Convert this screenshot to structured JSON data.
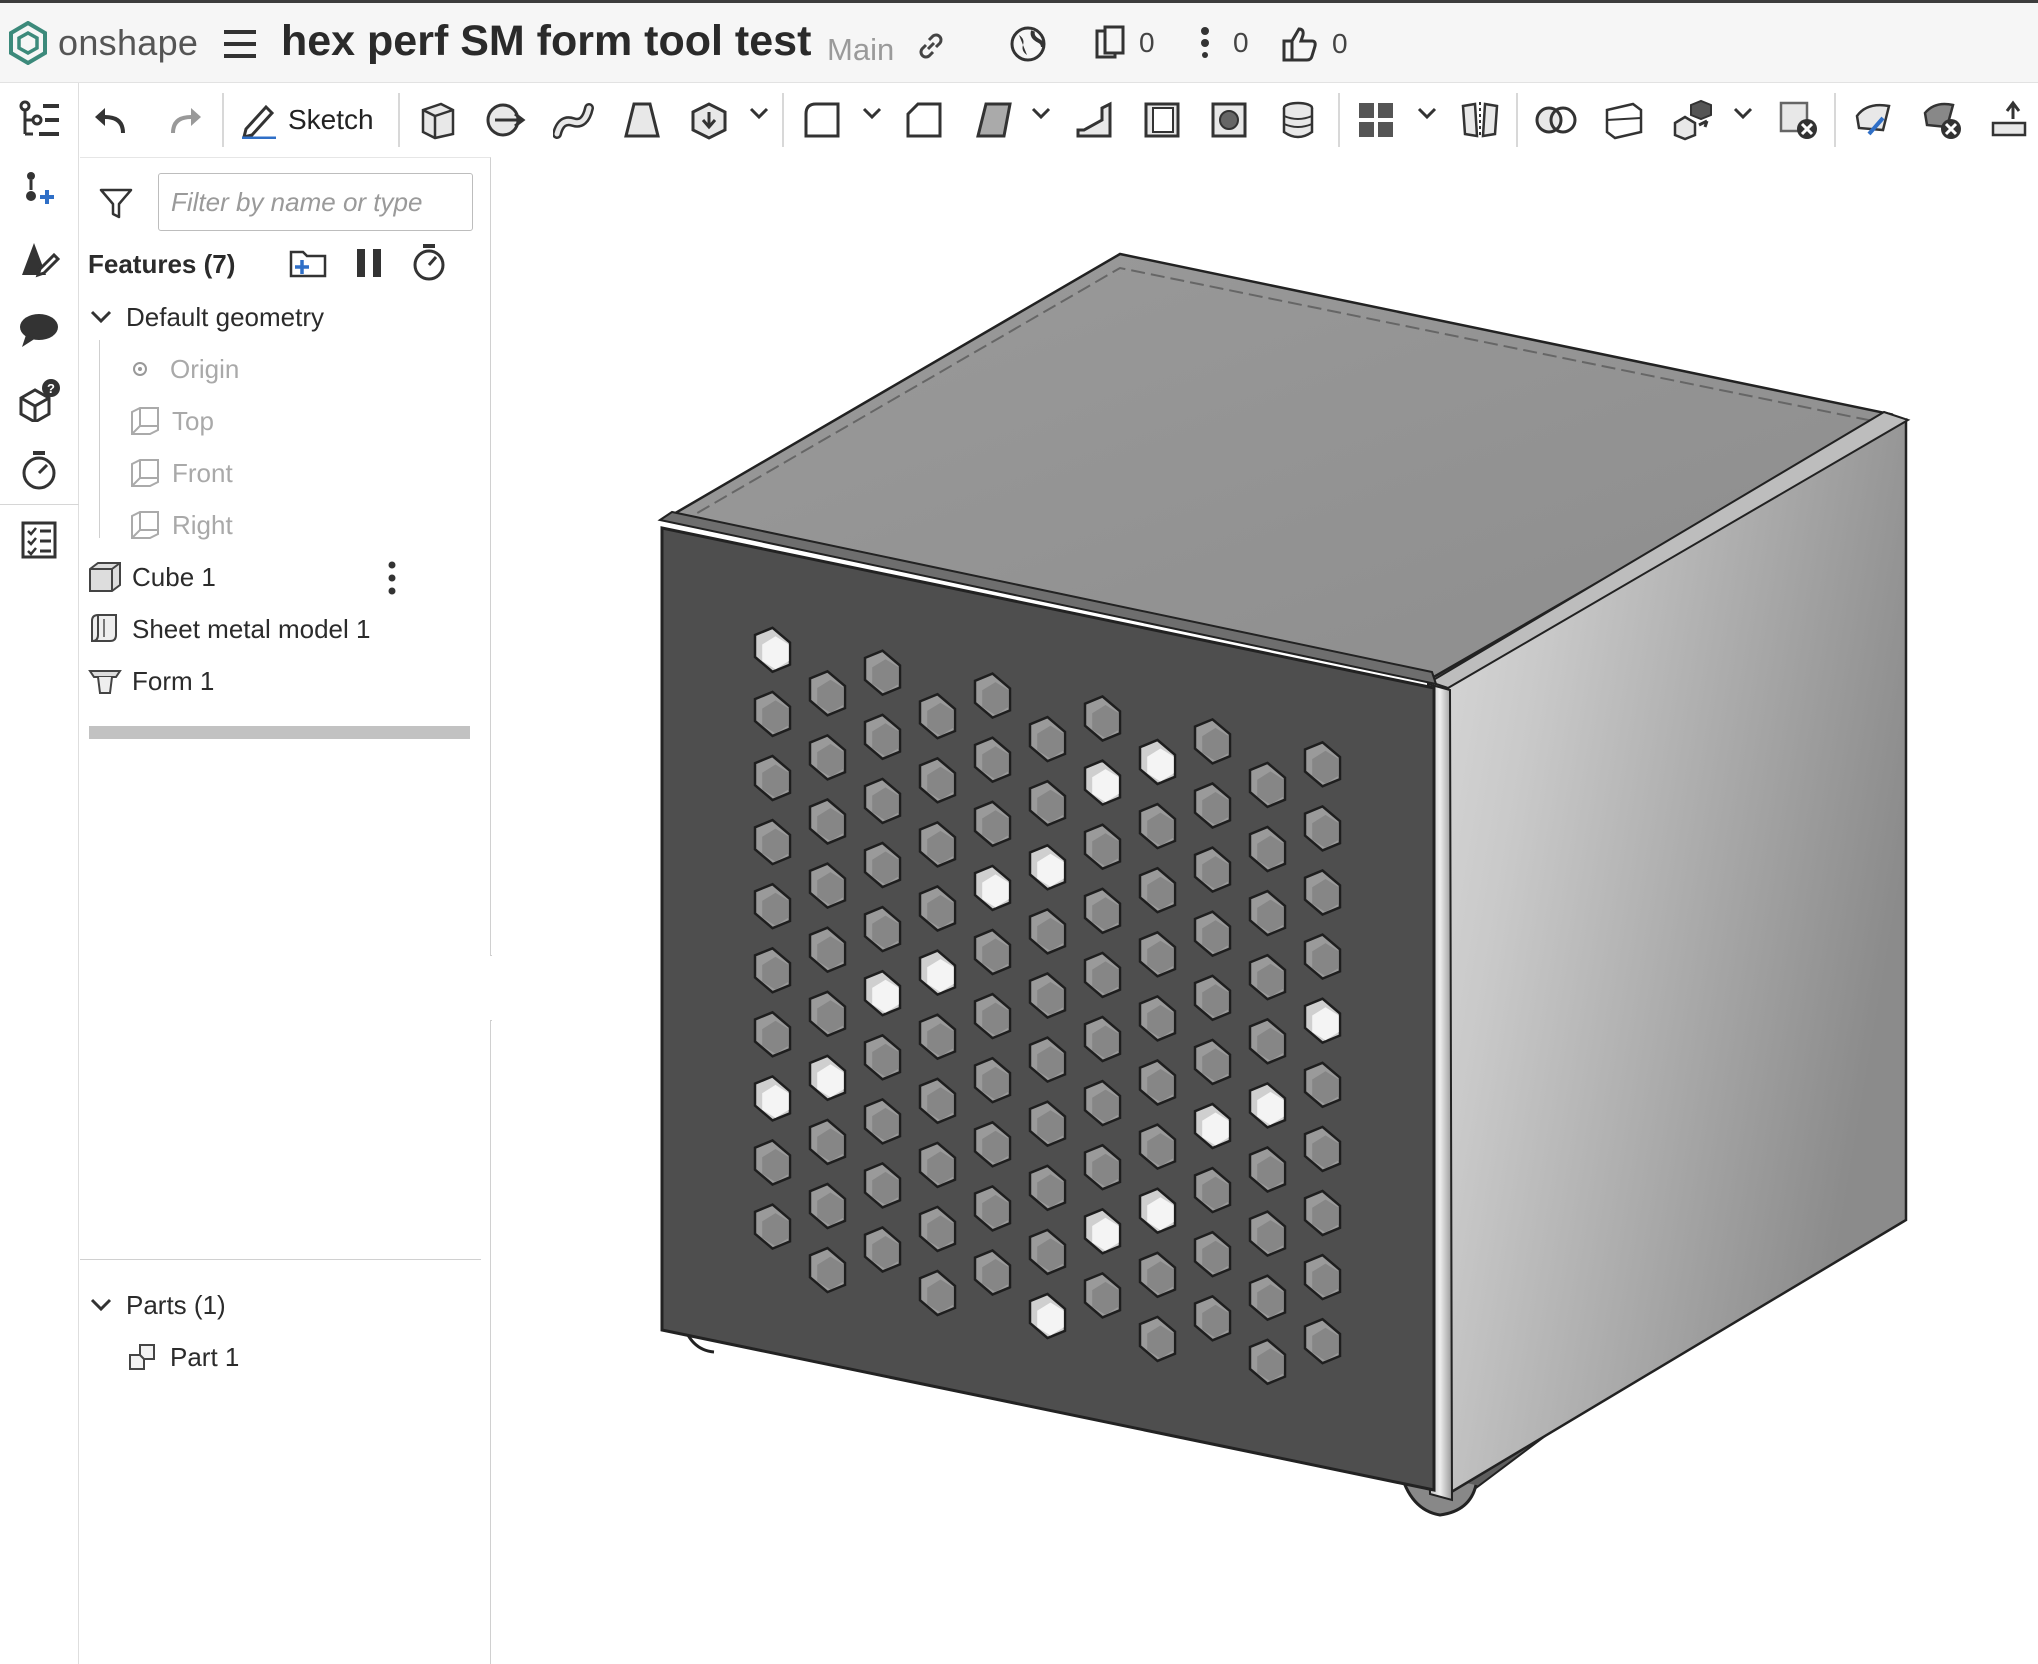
{
  "brand": {
    "name": "onshape"
  },
  "document": {
    "title": "hex perf SM form tool test",
    "branch": "Main"
  },
  "topbar_counts": {
    "versions": "0",
    "branches": "0",
    "likes": "0"
  },
  "toolbar": {
    "sketch_label": "Sketch"
  },
  "filter": {
    "placeholder": "Filter by name or type"
  },
  "features": {
    "header": "Features (7)",
    "default_geometry": "Default geometry",
    "planes": [
      "Origin",
      "Top",
      "Front",
      "Right"
    ],
    "items": [
      "Cube 1",
      "Sheet metal model 1",
      "Form 1"
    ]
  },
  "parts": {
    "header": "Parts (1)",
    "items": [
      "Part 1"
    ]
  },
  "colors": {
    "brand_green": "#3c8a7b",
    "accent_blue": "#2f6fc7",
    "model_face": "#4e4e4e"
  }
}
